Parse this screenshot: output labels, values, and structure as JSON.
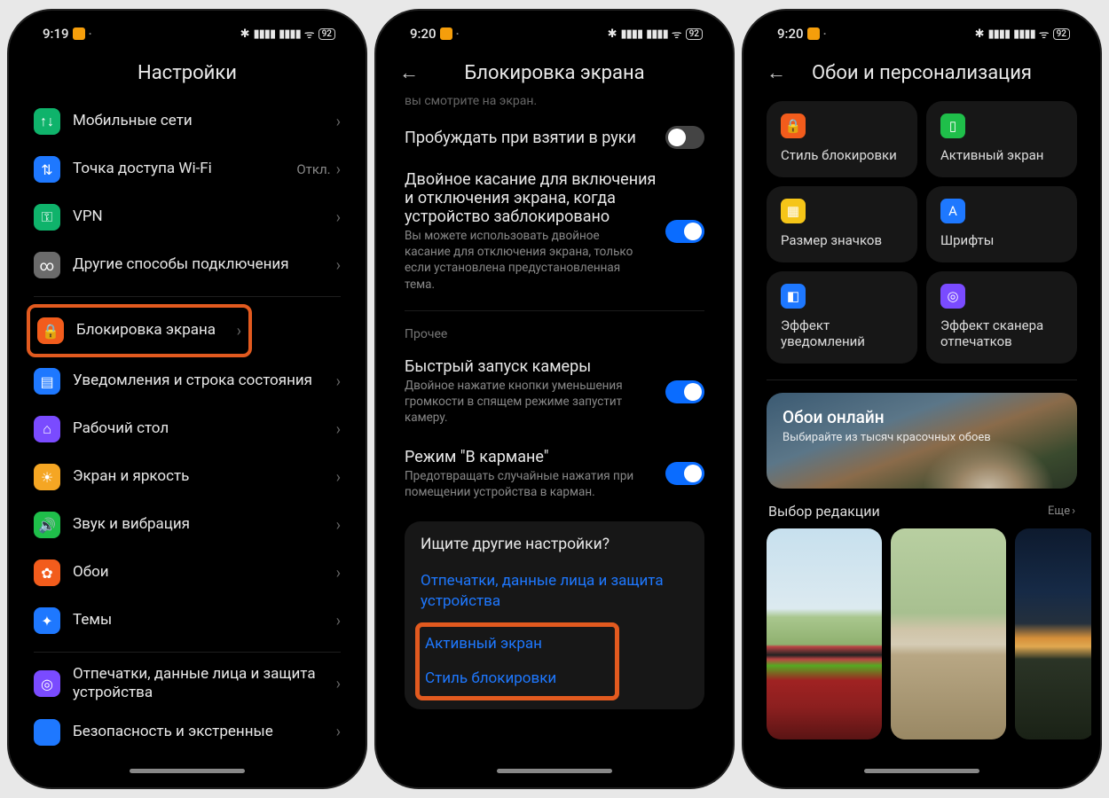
{
  "status": {
    "times": [
      "9:19",
      "9:20",
      "9:20"
    ],
    "battery_icon": "92"
  },
  "s1": {
    "title": "Настройки",
    "items": [
      {
        "label": "Мобильные сети",
        "name": "mobile-networks",
        "color": "#0fb36b",
        "glyph": "↑↓"
      },
      {
        "label": "Точка доступа Wi-Fi",
        "name": "wifi-hotspot",
        "side": "Откл.",
        "color": "#1e78ff",
        "glyph": "⇅"
      },
      {
        "label": "VPN",
        "name": "vpn",
        "color": "#0fb36b",
        "glyph": "⚿"
      },
      {
        "label": "Другие способы подключения",
        "name": "other-connections",
        "color": "#6b6b6b",
        "glyph": "∞"
      }
    ],
    "highlighted": {
      "label": "Блокировка экрана",
      "name": "lock-screen",
      "color": "#f25c1c",
      "glyph": "🔒"
    },
    "items2": [
      {
        "label": "Уведомления и строка состояния",
        "name": "notifications-statusbar",
        "color": "#1e78ff",
        "glyph": "▤"
      },
      {
        "label": "Рабочий стол",
        "name": "home-screen",
        "color": "#7a4bff",
        "glyph": "⌂"
      },
      {
        "label": "Экран и яркость",
        "name": "display-brightness",
        "color": "#f5a623",
        "glyph": "☀"
      },
      {
        "label": "Звук и вибрация",
        "name": "sound-vibration",
        "color": "#1fbf4a",
        "glyph": "🔊"
      },
      {
        "label": "Обои",
        "name": "wallpaper",
        "color": "#f25c1c",
        "glyph": "✿"
      },
      {
        "label": "Темы",
        "name": "themes",
        "color": "#1e78ff",
        "glyph": "✦"
      }
    ],
    "items3": [
      {
        "label": "Отпечатки, данные лица и защита устройства",
        "name": "biometrics-security",
        "color": "#7a4bff",
        "glyph": "◎"
      },
      {
        "label": "Безопасность и экстренные",
        "name": "safety-emergency",
        "color": "#1e78ff",
        "glyph": ""
      }
    ]
  },
  "s2": {
    "title": "Блокировка экрана",
    "cut_prev": "вы смотрите на экран.",
    "opts": [
      {
        "title": "Пробуждать при взятии в руки",
        "desc": "",
        "on": false,
        "name": "raise-to-wake"
      },
      {
        "title": "Двойное касание для включения и отключения экрана, когда устройство заблокировано",
        "desc": "Вы можете использовать двойное касание для отключения экрана, только если установлена предустановленная тема.",
        "on": true,
        "name": "double-tap-screen"
      }
    ],
    "sect_label": "Прочее",
    "opts2": [
      {
        "title": "Быстрый запуск камеры",
        "desc": "Двойное нажатие кнопки уменьшения громкости в спящем режиме запустит камеру.",
        "on": true,
        "name": "quick-camera"
      },
      {
        "title": "Режим \"В кармане\"",
        "desc": "Предотвращать случайные нажатия при помещении устройства в карман.",
        "on": true,
        "name": "pocket-mode"
      }
    ],
    "panel_head": "Ищите другие настройки?",
    "panel_link_top": "Отпечатки, данные лица и защита устройства",
    "panel_links": [
      "Активный экран",
      "Стиль блокировки"
    ]
  },
  "s3": {
    "title": "Обои и персонализация",
    "tiles": [
      {
        "label": "Стиль блокировки",
        "name": "lock-style",
        "color": "#f25c1c",
        "glyph": "🔒"
      },
      {
        "label": "Активный экран",
        "name": "always-on-display",
        "color": "#1fbf4a",
        "glyph": "▯"
      },
      {
        "label": "Размер значков",
        "name": "icon-size",
        "color": "#f5c518",
        "glyph": "▦"
      },
      {
        "label": "Шрифты",
        "name": "fonts",
        "color": "#1e78ff",
        "glyph": "A"
      },
      {
        "label": "Эффект уведомлений",
        "name": "notification-effect",
        "color": "#1e78ff",
        "glyph": "◧"
      },
      {
        "label": "Эффект сканера отпечатков",
        "name": "fingerprint-scanner-effect",
        "color": "#7a4bff",
        "glyph": "◎"
      }
    ],
    "banner": {
      "title": "Обои онлайн",
      "sub": "Выбирайте из тысяч красочных обоев"
    },
    "editors": {
      "title": "Выбор редакции",
      "more": "Еще"
    }
  }
}
